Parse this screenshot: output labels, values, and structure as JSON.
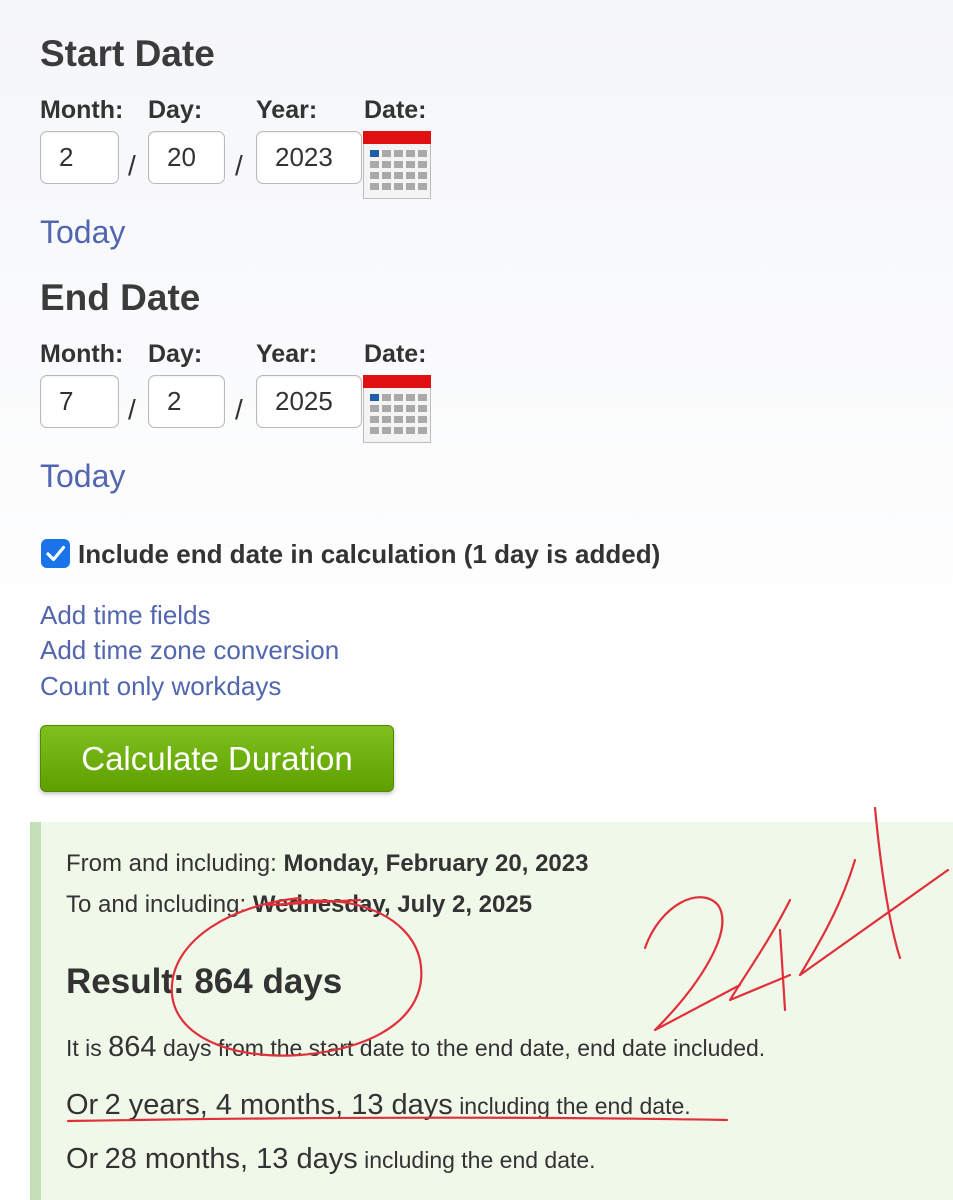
{
  "start": {
    "heading": "Start Date",
    "labels": {
      "month": "Month:",
      "day": "Day:",
      "year": "Year:",
      "date": "Date:"
    },
    "month": "2",
    "day": "20",
    "year": "2023",
    "separator": "/",
    "today": "Today"
  },
  "end": {
    "heading": "End Date",
    "labels": {
      "month": "Month:",
      "day": "Day:",
      "year": "Year:",
      "date": "Date:"
    },
    "month": "7",
    "day": "2",
    "year": "2025",
    "separator": "/",
    "today": "Today"
  },
  "include_end": {
    "label": "Include end date in calculation (1 day is added)",
    "checked": true
  },
  "links": [
    "Add time fields",
    "Add time zone conversion",
    "Count only workdays"
  ],
  "calculate_button": "Calculate Duration",
  "result": {
    "from_label": "From and including:",
    "from_value": "Monday, February 20, 2023",
    "to_label": "To and including:",
    "to_value": "Wednesday, July 2, 2025",
    "title": "Result: 864 days",
    "line1_a": "It is",
    "line1_num": "864",
    "line1_b": "days from the start date to the end date, end date included.",
    "line2_a": "Or",
    "line2_big": "2 years, 4 months, 13 days",
    "line2_b": "including the end date.",
    "line3_a": "Or",
    "line3_big": "28 months, 13 days",
    "line3_b": "including the end date."
  },
  "handwriting": {
    "text": "244",
    "color": "#e0303a"
  },
  "colors": {
    "link": "#5266b0",
    "button": "#6aab0a",
    "checkbox": "#1a73e8",
    "result_bg": "#f0f8ea",
    "calendar_top": "#e01010"
  },
  "icons": [
    "calendar-icon",
    "checkmark-icon"
  ]
}
